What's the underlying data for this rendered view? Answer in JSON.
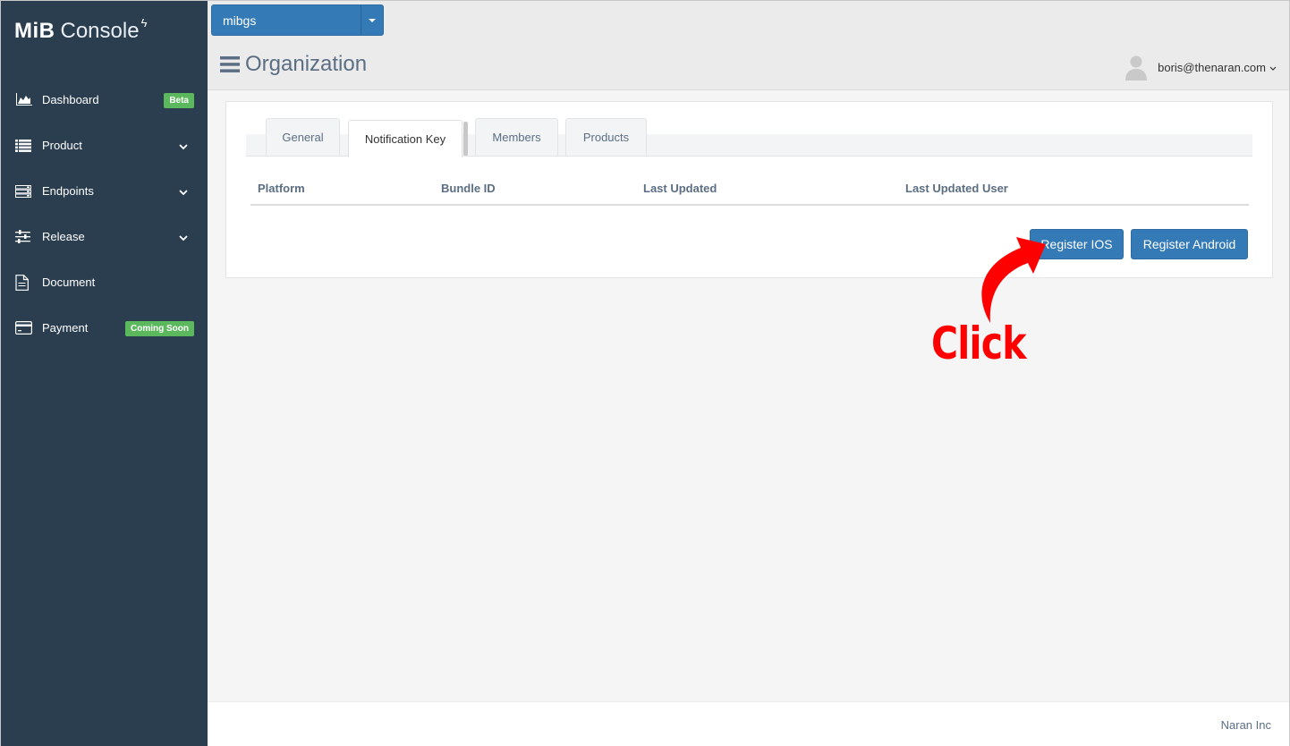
{
  "app": {
    "logo_brand": "MiB",
    "logo_product": "Console",
    "logo_mark": "ϟ"
  },
  "sidebar": {
    "items": [
      {
        "label": "Dashboard",
        "icon": "area-chart-icon",
        "badge": "Beta"
      },
      {
        "label": "Product",
        "icon": "list-icon",
        "expandable": true
      },
      {
        "label": "Endpoints",
        "icon": "server-icon",
        "expandable": true
      },
      {
        "label": "Release",
        "icon": "sliders-icon",
        "expandable": true
      },
      {
        "label": "Document",
        "icon": "document-icon"
      },
      {
        "label": "Payment",
        "icon": "credit-card-icon",
        "badge": "Coming Soon"
      }
    ]
  },
  "header": {
    "org_select": {
      "selected": "mibgs"
    },
    "title": "Organization",
    "user_email": "boris@thenaran.com"
  },
  "tabs": [
    {
      "label": "General",
      "active": false
    },
    {
      "label": "Notification Key",
      "active": true
    },
    {
      "label": "Members",
      "active": false
    },
    {
      "label": "Products",
      "active": false
    }
  ],
  "table": {
    "columns": [
      "Platform",
      "Bundle ID",
      "Last Updated",
      "Last Updated User"
    ],
    "rows": []
  },
  "actions": {
    "register_ios": "Register IOS",
    "register_android": "Register Android"
  },
  "annotation": {
    "text": "Click"
  },
  "footer": {
    "company": "Naran Inc"
  },
  "colors": {
    "sidebar_bg": "#2b3e50",
    "primary": "#337ab7",
    "badge_green": "#5cb85c",
    "annotation_red": "#ff0000",
    "muted_text": "#5b6e84"
  }
}
